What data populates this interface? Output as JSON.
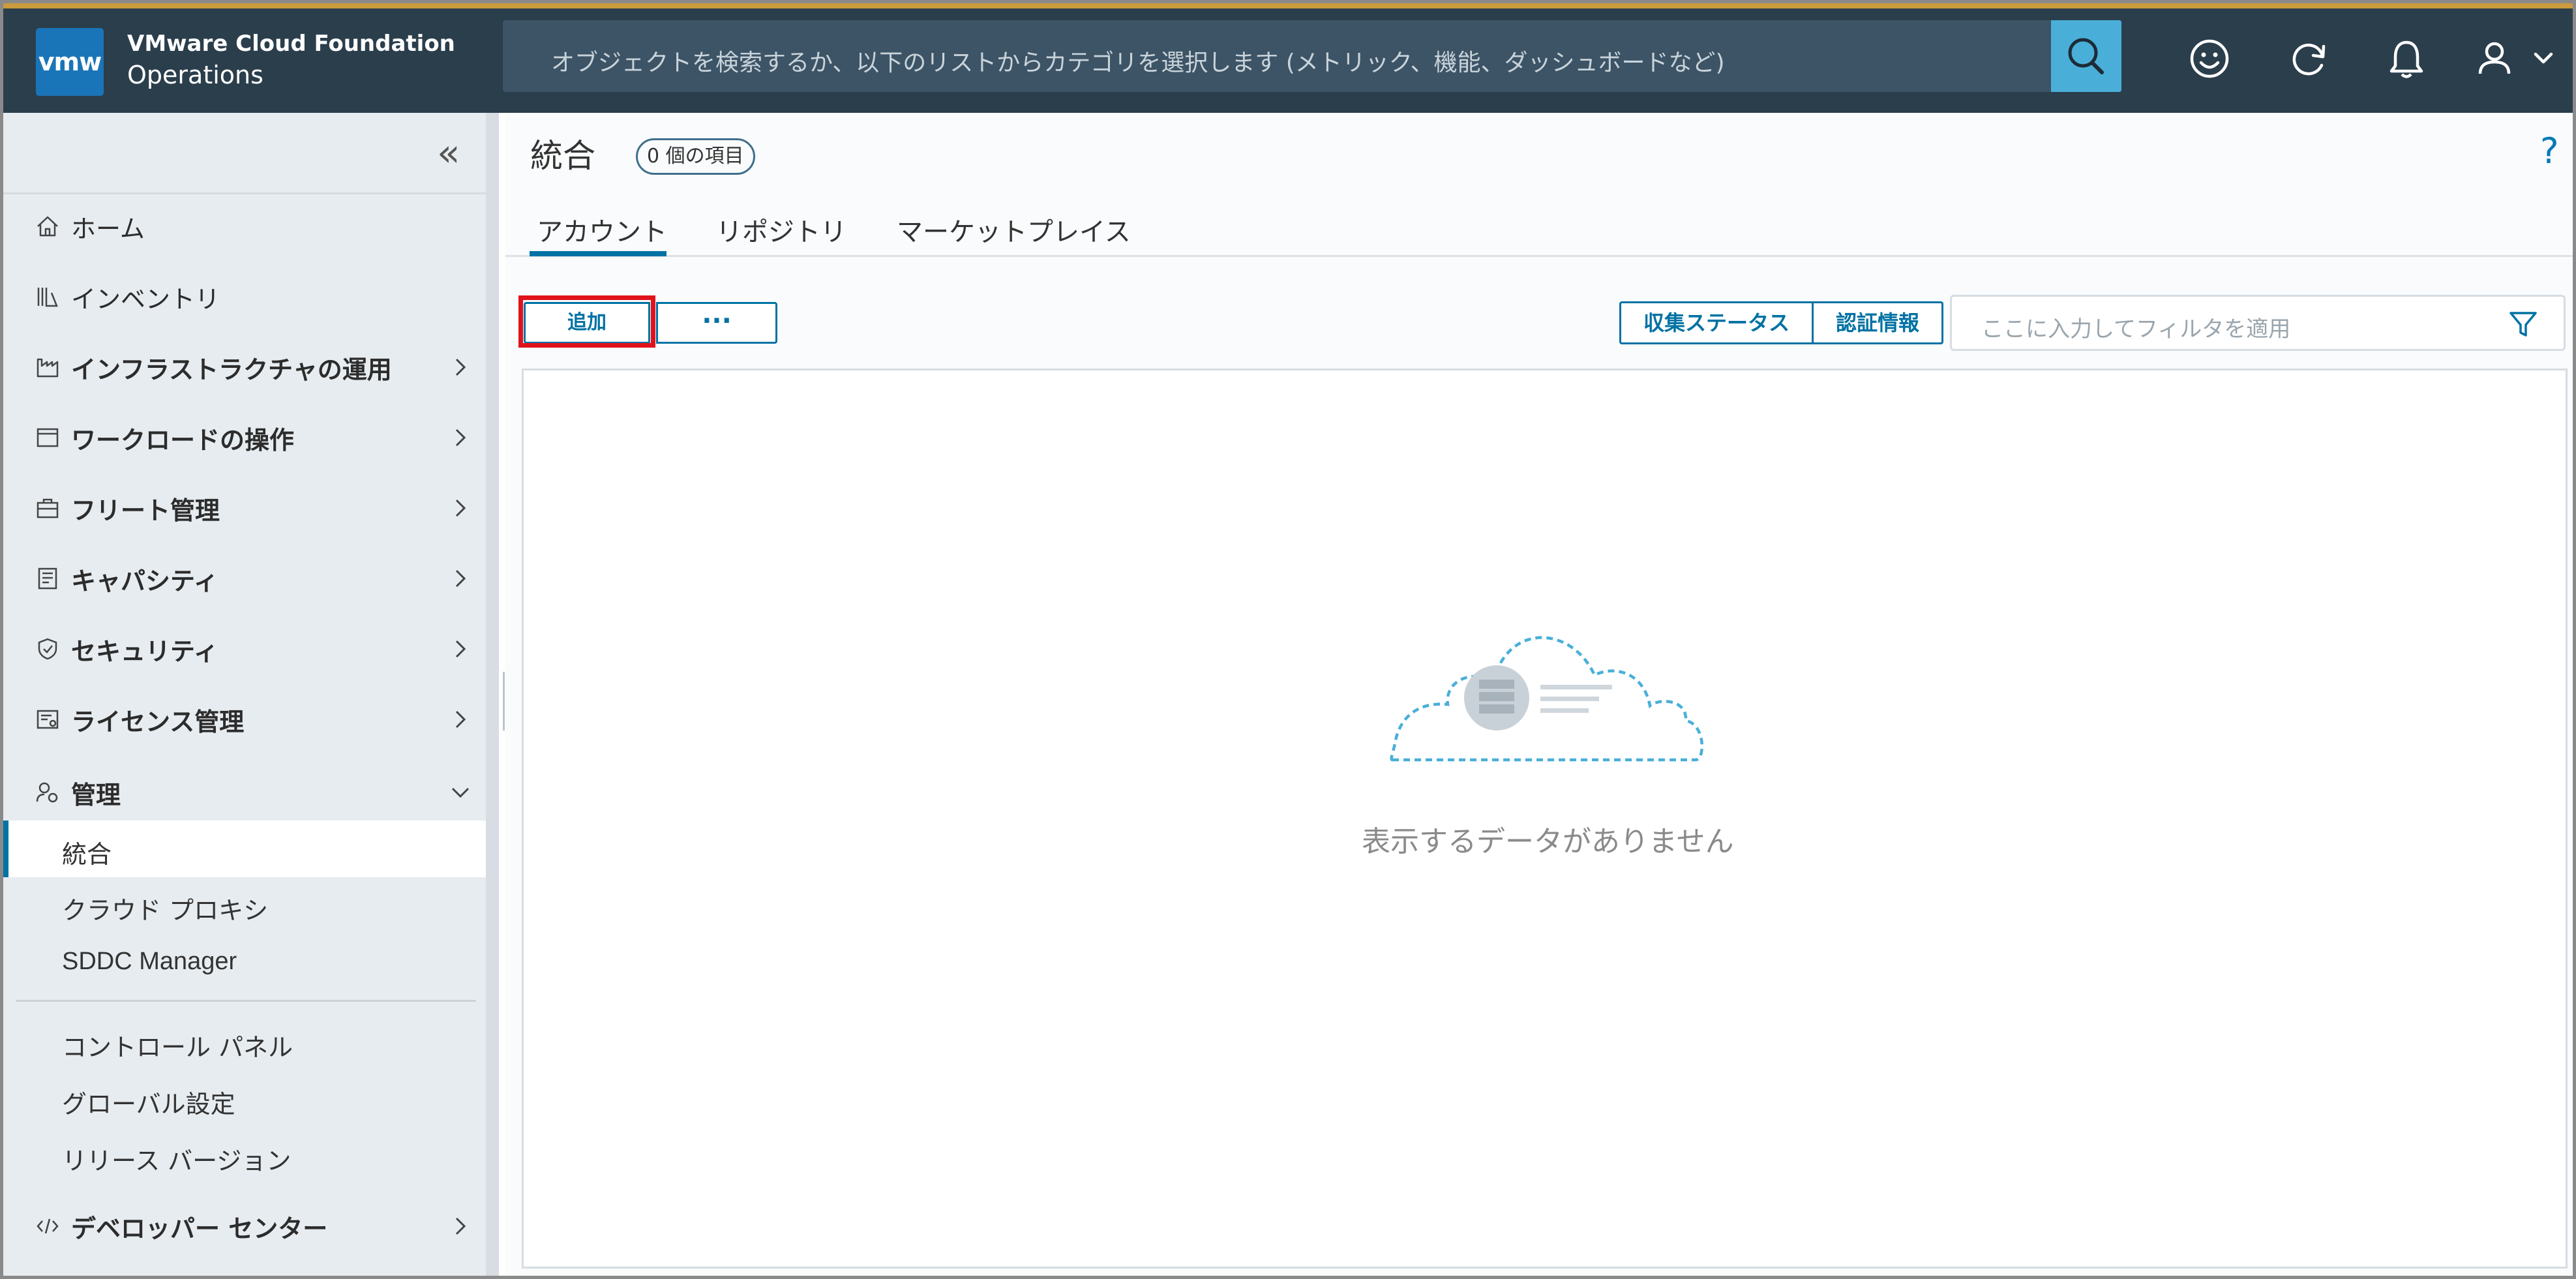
{
  "header": {
    "logo_text": "vmw",
    "brand_line1": "VMware Cloud Foundation",
    "brand_line2": "Operations",
    "search_placeholder": "オブジェクトを検索するか、以下のリストからカテゴリを選択します (メトリック、機能、ダッシュボードなど)",
    "icons": [
      "search-icon",
      "smiley-icon",
      "refresh-icon",
      "bell-icon",
      "user-icon",
      "chevron-down-icon"
    ],
    "accent_color": "#c99b3c",
    "bg_color": "#2b3e4c"
  },
  "sidebar": {
    "collapse_glyph": "«",
    "items": [
      {
        "label": "ホーム",
        "icon": "home-icon"
      },
      {
        "label": "インベントリ",
        "icon": "inventory-icon"
      },
      {
        "label": "インフラストラクチャの運用",
        "icon": "factory-icon"
      },
      {
        "label": "ワークロードの操作",
        "icon": "window-icon"
      },
      {
        "label": "フリート管理",
        "icon": "briefcase-icon"
      },
      {
        "label": "キャパシティ",
        "icon": "capacity-icon"
      },
      {
        "label": "セキュリティ",
        "icon": "shield-icon"
      },
      {
        "label": "ライセンス管理",
        "icon": "license-icon"
      },
      {
        "label": "管理",
        "icon": "admin-icon"
      },
      {
        "label": "デベロッパー センター",
        "icon": "code-icon"
      }
    ],
    "admin_sub_items": [
      {
        "label": "統合",
        "active": true
      },
      {
        "label": "クラウド プロキシ"
      },
      {
        "label": "SDDC Manager"
      },
      {
        "label": "コントロール パネル"
      },
      {
        "label": "グローバル設定"
      },
      {
        "label": "リリース バージョン"
      }
    ]
  },
  "main": {
    "title": "統合",
    "count_badge": "0 個の項目",
    "help": "?",
    "tabs": [
      {
        "label": "アカウント",
        "active": true
      },
      {
        "label": "リポジトリ"
      },
      {
        "label": "マーケットプレイス"
      }
    ],
    "toolbar": {
      "add_label": "追加",
      "more_label": "···",
      "collect_status_label": "収集ステータス",
      "credentials_label": "認証情報",
      "filter_placeholder": "ここに入力してフィルタを適用"
    },
    "empty_message": "表示するデータがありません",
    "accent_color": "#0072a3",
    "highlight_color": "#e0131b"
  }
}
